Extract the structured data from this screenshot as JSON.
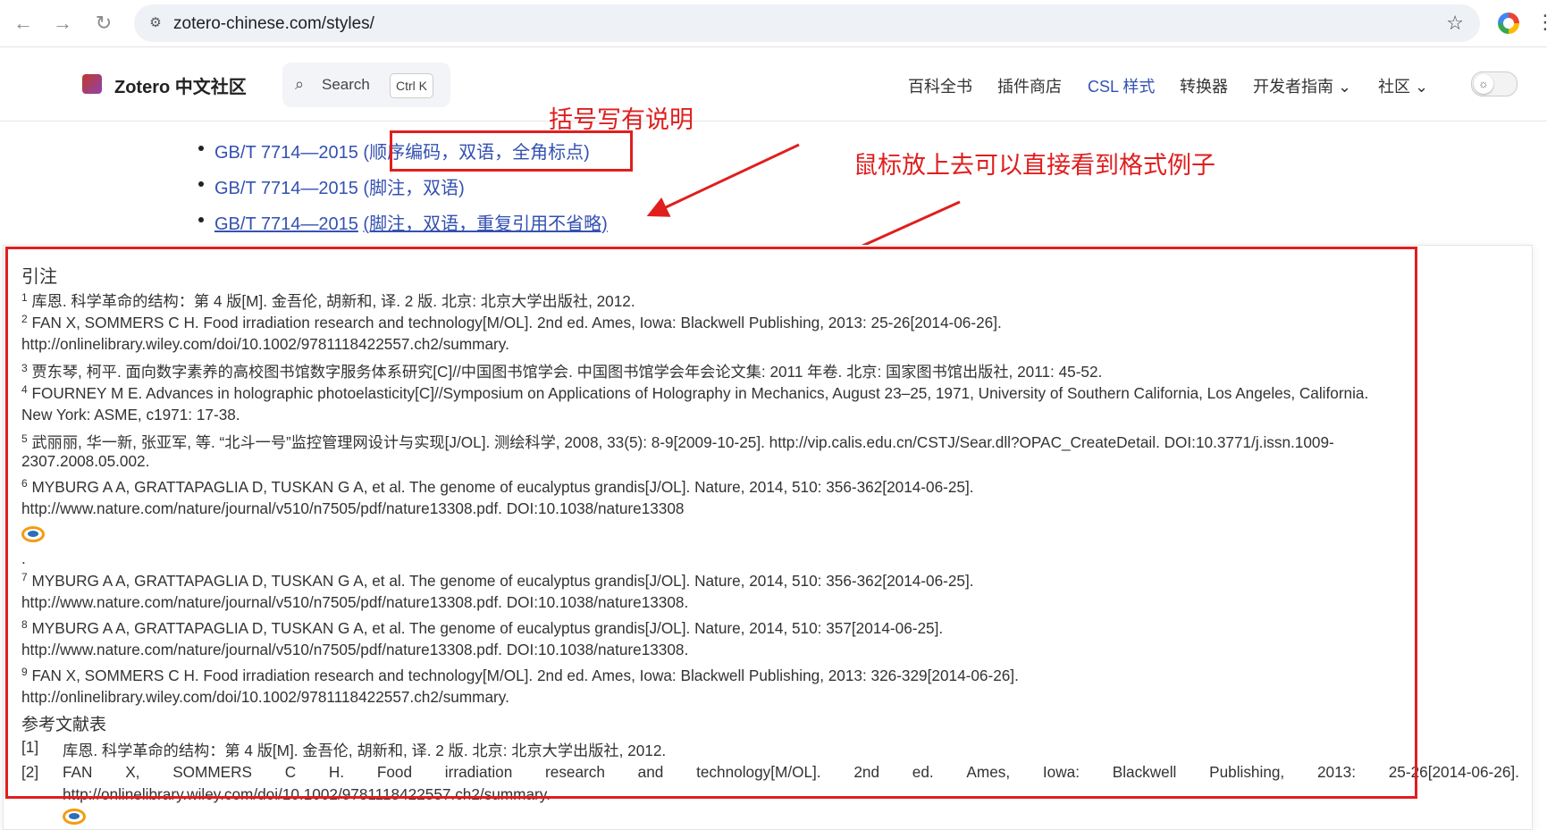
{
  "browser": {
    "url": "zotero-chinese.com/styles/",
    "back_icon": "←",
    "forward_icon": "→",
    "reload_icon": "↻",
    "star_icon": "☆"
  },
  "site": {
    "brand": "Zotero 中文社区",
    "search_placeholder": "Search",
    "search_shortcut": "Ctrl K",
    "nav": [
      {
        "label": "百科全书",
        "active": false
      },
      {
        "label": "插件商店",
        "active": false
      },
      {
        "label": "CSL 样式",
        "active": true
      },
      {
        "label": "转换器",
        "active": false
      },
      {
        "label": "开发者指南 ⌄",
        "active": false
      },
      {
        "label": "社区 ⌄",
        "active": false
      }
    ],
    "accent_color": "#3451b2"
  },
  "list": {
    "items": [
      {
        "title": "GB/T 7714—2015",
        "suffix": "(顺序编码，双语，全角标点)"
      },
      {
        "title": "GB/T 7714—2015",
        "suffix": "(脚注，双语)"
      },
      {
        "title": "GB/T 7714—2015",
        "suffix": "(脚注，双语，重复引用不省略)"
      }
    ]
  },
  "annotations": {
    "bracket_note": "括号写有说明",
    "hover_note": "鼠标放上去可以直接看到格式例子",
    "color": "#e01e1e"
  },
  "popup": {
    "citation_title": "引注",
    "citations": [
      {
        "n": "1",
        "lines": [
          "库恩. 科学革命的结构：第 4 版[M]. 金吾伦, 胡新和, 译. 2 版. 北京: 北京大学出版社, 2012."
        ]
      },
      {
        "n": "2",
        "lines": [
          "FAN X, SOMMERS C H. Food irradiation research and technology[M/OL]. 2nd ed. Ames, Iowa: Blackwell Publishing, 2013: 25-26[2014-06-26].",
          "http://onlinelibrary.wiley.com/doi/10.1002/9781118422557.ch2/summary."
        ]
      },
      {
        "n": "3",
        "lines": [
          "贾东琴, 柯平. 面向数字素养的高校图书馆数字服务体系研究[C]//中国图书馆学会. 中国图书馆学会年会论文集: 2011 年卷. 北京: 国家图书馆出版社, 2011: 45-52."
        ]
      },
      {
        "n": "4",
        "lines": [
          "FOURNEY M E. Advances in holographic photoelasticity[C]//Symposium on Applications of Holography in Mechanics, August 23–25, 1971, University of Southern California, Los Angeles, California.",
          "New York: ASME, c1971: 17-38."
        ]
      },
      {
        "n": "5",
        "lines": [
          "武丽丽, 华一新, 张亚军, 等. “北斗一号”监控管理网设计与实现[J/OL]. 测绘科学, 2008, 33(5): 8-9[2009-10-25]. http://vip.calis.edu.cn/CSTJ/Sear.dll?OPAC_CreateDetail. DOI:10.3771/j.issn.1009-",
          "2307.2008.05.002."
        ]
      },
      {
        "n": "6",
        "lines": [
          "MYBURG A A, GRATTAPAGLIA D, TUSKAN G A, et al. The genome of eucalyptus grandis[J/OL]. Nature, 2014, 510: 356-362[2014-06-25].",
          "http://www.nature.com/nature/journal/v510/n7505/pdf/nature13308.pdf. DOI:10.1038/nature13308"
        ]
      },
      {
        "n": "7",
        "lines": [
          "MYBURG A A, GRATTAPAGLIA D, TUSKAN G A, et al. The genome of eucalyptus grandis[J/OL]. Nature, 2014, 510: 356-362[2014-06-25].",
          "http://www.nature.com/nature/journal/v510/n7505/pdf/nature13308.pdf. DOI:10.1038/nature13308."
        ]
      },
      {
        "n": "8",
        "lines": [
          "MYBURG A A, GRATTAPAGLIA D, TUSKAN G A, et al. The genome of eucalyptus grandis[J/OL]. Nature, 2014, 510: 357[2014-06-25].",
          "http://www.nature.com/nature/journal/v510/n7505/pdf/nature13308.pdf. DOI:10.1038/nature13308."
        ]
      },
      {
        "n": "9",
        "lines": [
          "FAN X, SOMMERS C H. Food irradiation research and technology[M/OL]. 2nd ed. Ames, Iowa: Blackwell Publishing, 2013: 326-329[2014-06-26].",
          "http://onlinelibrary.wiley.com/doi/10.1002/9781118422557.ch2/summary."
        ]
      }
    ],
    "dot_line": ".",
    "bibliography_title": "参考文献表",
    "bibliography": [
      {
        "label": "[1]",
        "text": "库恩. 科学革命的结构：第 4 版[M]. 金吾伦, 胡新和, 译. 2 版. 北京: 北京大学出版社, 2012."
      },
      {
        "label": "[2]",
        "words": [
          "FAN",
          "X,",
          "SOMMERS",
          "C",
          "H.",
          "Food",
          "irradiation",
          "research",
          "and",
          "technology[M/OL].",
          "2nd",
          "ed.",
          "Ames,",
          "Iowa:",
          "Blackwell",
          "Publishing,",
          "2013:",
          "25-26[2014-06-26]."
        ],
        "line2": "http://onlinelibrary.wiley.com/doi/10.1002/9781118422557.ch2/summary."
      }
    ]
  }
}
